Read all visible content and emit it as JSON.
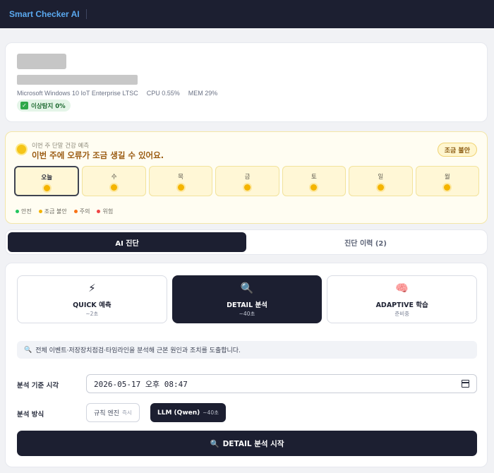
{
  "app": {
    "title": "Smart Checker AI"
  },
  "device": {
    "os": "Microsoft Windows 10 IoT Enterprise LTSC",
    "cpu": "CPU 0.55%",
    "mem": "MEM 29%",
    "anomaly_label": "이상탐지 0%"
  },
  "forecast": {
    "subtitle": "이번 주 단말 건강 예측",
    "title": "이번 주에 오류가 조금 생길 수 있어요.",
    "badge": "조금 불안",
    "days": [
      {
        "label": "오늘",
        "status": "caution"
      },
      {
        "label": "수",
        "status": "caution"
      },
      {
        "label": "목",
        "status": "caution"
      },
      {
        "label": "금",
        "status": "caution"
      },
      {
        "label": "토",
        "status": "caution"
      },
      {
        "label": "일",
        "status": "caution"
      },
      {
        "label": "월",
        "status": "caution"
      }
    ],
    "legend": [
      {
        "label": "안전",
        "color": "#22c55e"
      },
      {
        "label": "조금 불안",
        "color": "#f4b400"
      },
      {
        "label": "주의",
        "color": "#f97316"
      },
      {
        "label": "위험",
        "color": "#ef4444"
      }
    ]
  },
  "tabs": [
    {
      "label": "AI 진단",
      "active": true
    },
    {
      "label": "진단 이력 (2)",
      "active": false
    }
  ],
  "modes": [
    {
      "icon": "lightning-icon",
      "glyph": "⚡",
      "title": "QUICK 예측",
      "subtitle": "~2초"
    },
    {
      "icon": "magnifier-icon",
      "glyph": "🔍",
      "title": "DETAIL 분석",
      "subtitle": "~40초"
    },
    {
      "icon": "brain-icon",
      "glyph": "🧠",
      "title": "ADAPTIVE 학습",
      "subtitle": "준비중"
    }
  ],
  "description": "전체 이벤트·저장장치점검·타임라인을 분석해 근본 원인과 조치를 도출합니다.",
  "analysis_time": {
    "label": "분석 기준 시각",
    "value": "2026-05-17 오후 08:47"
  },
  "method": {
    "label": "분석 방식",
    "options": [
      {
        "name": "규칙 엔진",
        "note": "즉시"
      },
      {
        "name": "LLM (Qwen)",
        "note": "~40초"
      }
    ]
  },
  "start_button": "DETAIL 분석 시작",
  "colors": {
    "dark": "#1c1f31",
    "brand": "#5aa9f0",
    "caution": "#f4b400"
  }
}
